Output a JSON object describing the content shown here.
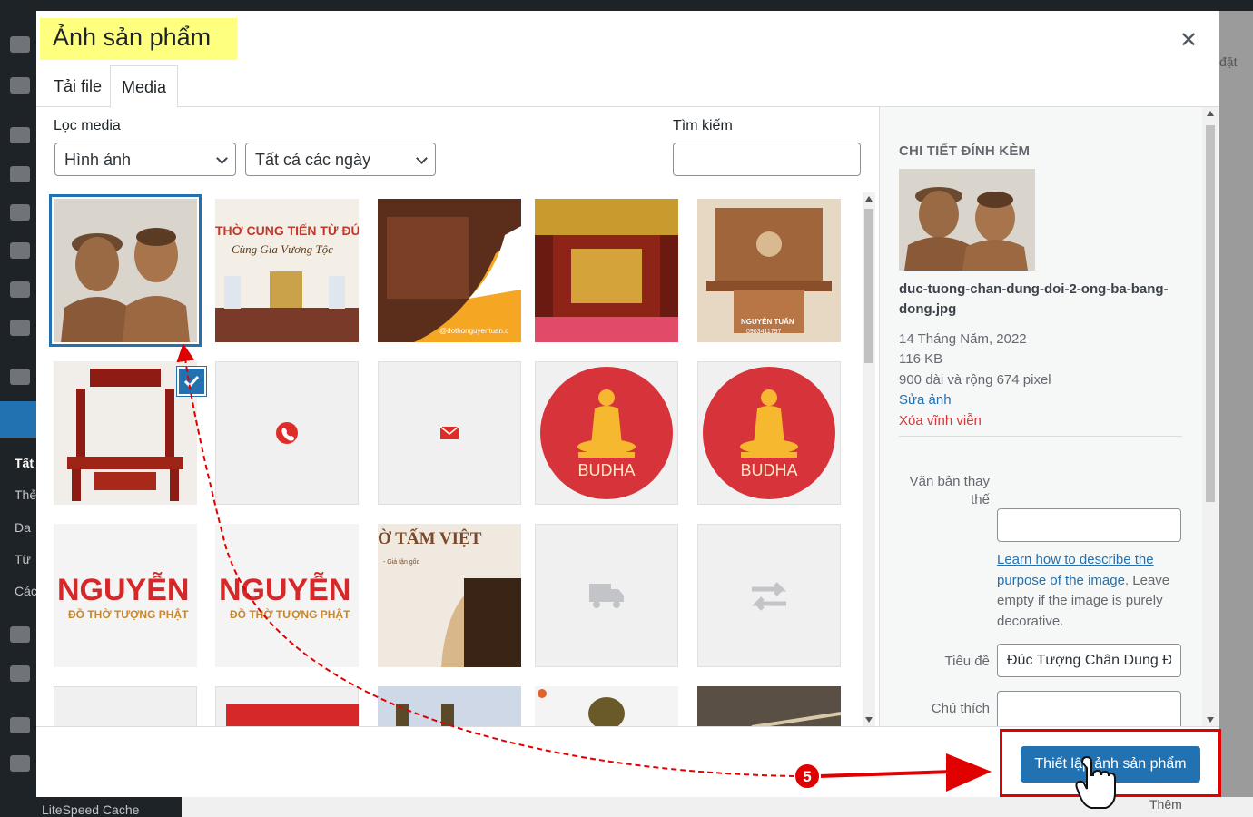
{
  "background": {
    "sidebar_labels": [
      "Tất",
      "Thẻ",
      "Da",
      "Từ",
      "Các"
    ],
    "bottom_label": "LiteSpeed Cache",
    "right_label": "đặt",
    "bottom_right_label": "Thêm"
  },
  "modal": {
    "title": "Ảnh sản phẩm",
    "tabs": [
      {
        "label": "Tải file",
        "active": false
      },
      {
        "label": "Media",
        "active": true
      }
    ]
  },
  "filters": {
    "label": "Lọc media",
    "type_selected": "Hình ảnh",
    "date_selected": "Tất cả các ngày"
  },
  "search": {
    "label": "Tìm kiếm",
    "value": ""
  },
  "media_items": [
    {
      "kind": "photo",
      "desc": "bronze busts",
      "selected": true
    },
    {
      "kind": "banner",
      "text1": "THỜ CUNG TIẾN TỪ ĐỨC",
      "text2": "Cùng Gia Vương Tộc"
    },
    {
      "kind": "photo",
      "desc": "altar banner",
      "text1": "@dothonguyentuan.c"
    },
    {
      "kind": "photo",
      "desc": "red gold altar"
    },
    {
      "kind": "photo",
      "desc": "wooden altar",
      "text1": "NGUYỄN TUẤN",
      "text2": "0903411797"
    },
    {
      "kind": "photo",
      "desc": "red altar table"
    },
    {
      "kind": "icon",
      "icon": "phone-icon"
    },
    {
      "kind": "icon",
      "icon": "mail-icon"
    },
    {
      "kind": "logo",
      "text1": "BUDHA"
    },
    {
      "kind": "logo",
      "text1": "BUDHA"
    },
    {
      "kind": "banner",
      "text1": "NGUYỄN",
      "text2": "ĐỒ THỜ TƯỢNG PHẬT"
    },
    {
      "kind": "banner",
      "text1": "NGUYỄN",
      "text2": "ĐỒ THỜ TƯỢNG PHẬT"
    },
    {
      "kind": "banner",
      "text1": "Ờ TẤM VIỆT",
      "text2": "- Giá tận gốc"
    },
    {
      "kind": "icon",
      "icon": "truck-icon"
    },
    {
      "kind": "icon",
      "icon": "swap-icon"
    }
  ],
  "details": {
    "heading": "CHI TIẾT ĐÍNH KÈM",
    "filename": "duc-tuong-chan-dung-doi-2-ong-ba-bang-dong.jpg",
    "date": "14 Tháng Năm, 2022",
    "size": "116 KB",
    "dimensions": "900 dài và rộng 674 pixel",
    "edit_link": "Sửa ảnh",
    "delete_link": "Xóa vĩnh viễn",
    "alt_label": "Văn bản thay thế",
    "alt_label_line1": "Văn bản thay",
    "alt_label_line2": "thế",
    "alt_value": "",
    "help_link": "Learn how to describe the purpose of the image",
    "help_rest": ". Leave empty if the image is purely decorative.",
    "title_label": "Tiêu đề",
    "title_value": "Đúc Tượng Chân Dung Đ",
    "caption_label": "Chú thích",
    "caption_value": ""
  },
  "footer": {
    "button_label": "Thiết lập ảnh sản phẩm"
  },
  "annotation": {
    "step_number": "5",
    "accent_color": "#e00000"
  }
}
